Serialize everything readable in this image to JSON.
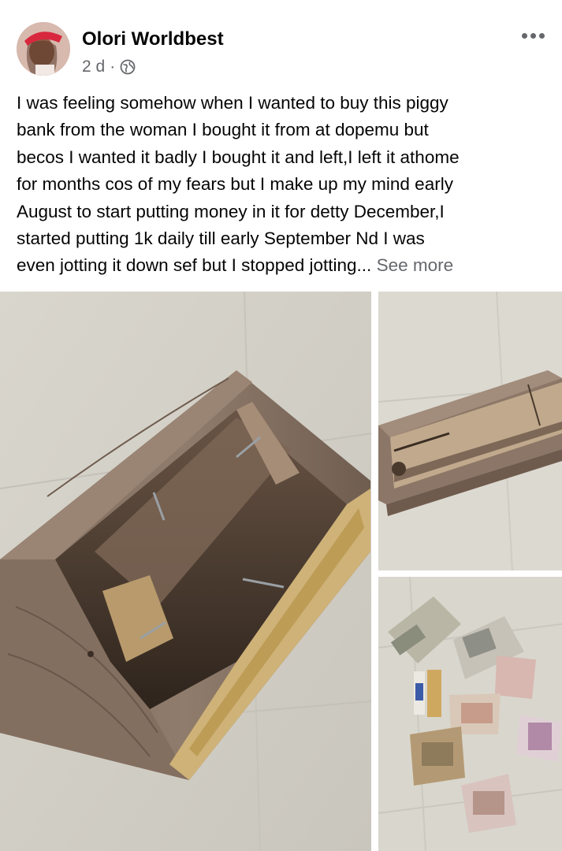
{
  "post": {
    "author": "Olori Worldbest",
    "time": "2 d",
    "separator": "·",
    "privacy_icon": "globe-icon",
    "more_icon": "more-horizontal-icon",
    "text_lines": [
      "I was feeling somehow when I wanted to buy this piggy",
      "bank from the woman I bought it from at dopemu but",
      "becos I wanted it badly I bought it and left,I left it athome",
      "for months  cos of my fears but I make up my mind early",
      "August to start putting money in it for detty December,I",
      "started putting 1k daily till early September Nd I was",
      "even jotting it down sef but I stopped jotting..."
    ],
    "see_more": "See more"
  },
  "colors": {
    "text": "#050505",
    "secondary": "#65676b",
    "wood": "#7a6656",
    "floor": "#d8d5cc"
  }
}
